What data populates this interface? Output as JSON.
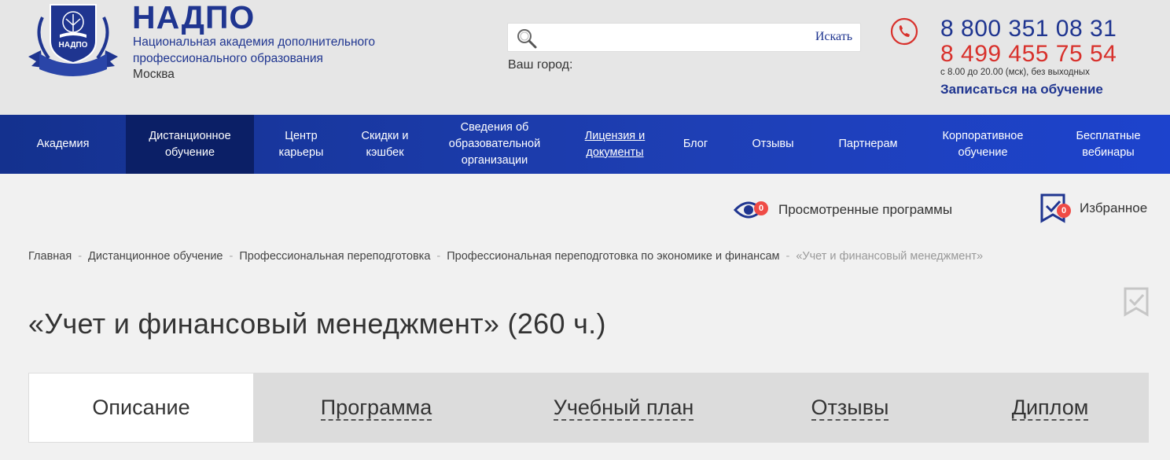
{
  "brand": {
    "logo_text": "НАДПО",
    "title": "НАДПО",
    "subtitle_line1": "Национальная академия дополнительного",
    "subtitle_line2": "профессионального образования",
    "city": "Москва",
    "color": "#1f3590"
  },
  "search": {
    "placeholder": "",
    "button_label": "Искать",
    "icon": "search-icon"
  },
  "city_label": "Ваш город:",
  "contacts": {
    "phone1": "8 800 351 08 31",
    "phone2": "8 499 455 75 54",
    "hours": "с 8.00 до 20.00 (мск), без выходных",
    "enroll_label": "Записаться на обучение",
    "phone_color": "#d8312c"
  },
  "nav": {
    "items": [
      {
        "label": "Академия"
      },
      {
        "label": "Дистанционное обучение",
        "active": true
      },
      {
        "label": "Центр карьеры"
      },
      {
        "label": "Скидки и кэшбек"
      },
      {
        "label": "Сведения об образовательной организации"
      },
      {
        "label": "Лицензия и документы",
        "underline": true
      },
      {
        "label": "Блог"
      },
      {
        "label": "Отзывы"
      },
      {
        "label": "Партнерам"
      },
      {
        "label": "Корпоративное обучение"
      },
      {
        "label": "Бесплатные вебинары"
      }
    ]
  },
  "tools": {
    "viewed_label": "Просмотренные программы",
    "viewed_count": "0",
    "favorites_label": "Избранное",
    "favorites_count": "0"
  },
  "breadcrumb": {
    "items": [
      "Главная",
      "Дистанционное обучение",
      "Профессиональная переподготовка",
      "Профессиональная переподготовка по экономике и финансам",
      "«Учет и финансовый менеджмент»"
    ],
    "separator": "-"
  },
  "page_title": "«Учет и финансовый менеджмент» (260 ч.)",
  "tabs": [
    {
      "label": "Описание",
      "active": true
    },
    {
      "label": "Программа"
    },
    {
      "label": "Учебный план"
    },
    {
      "label": "Отзывы"
    },
    {
      "label": "Диплом"
    }
  ]
}
